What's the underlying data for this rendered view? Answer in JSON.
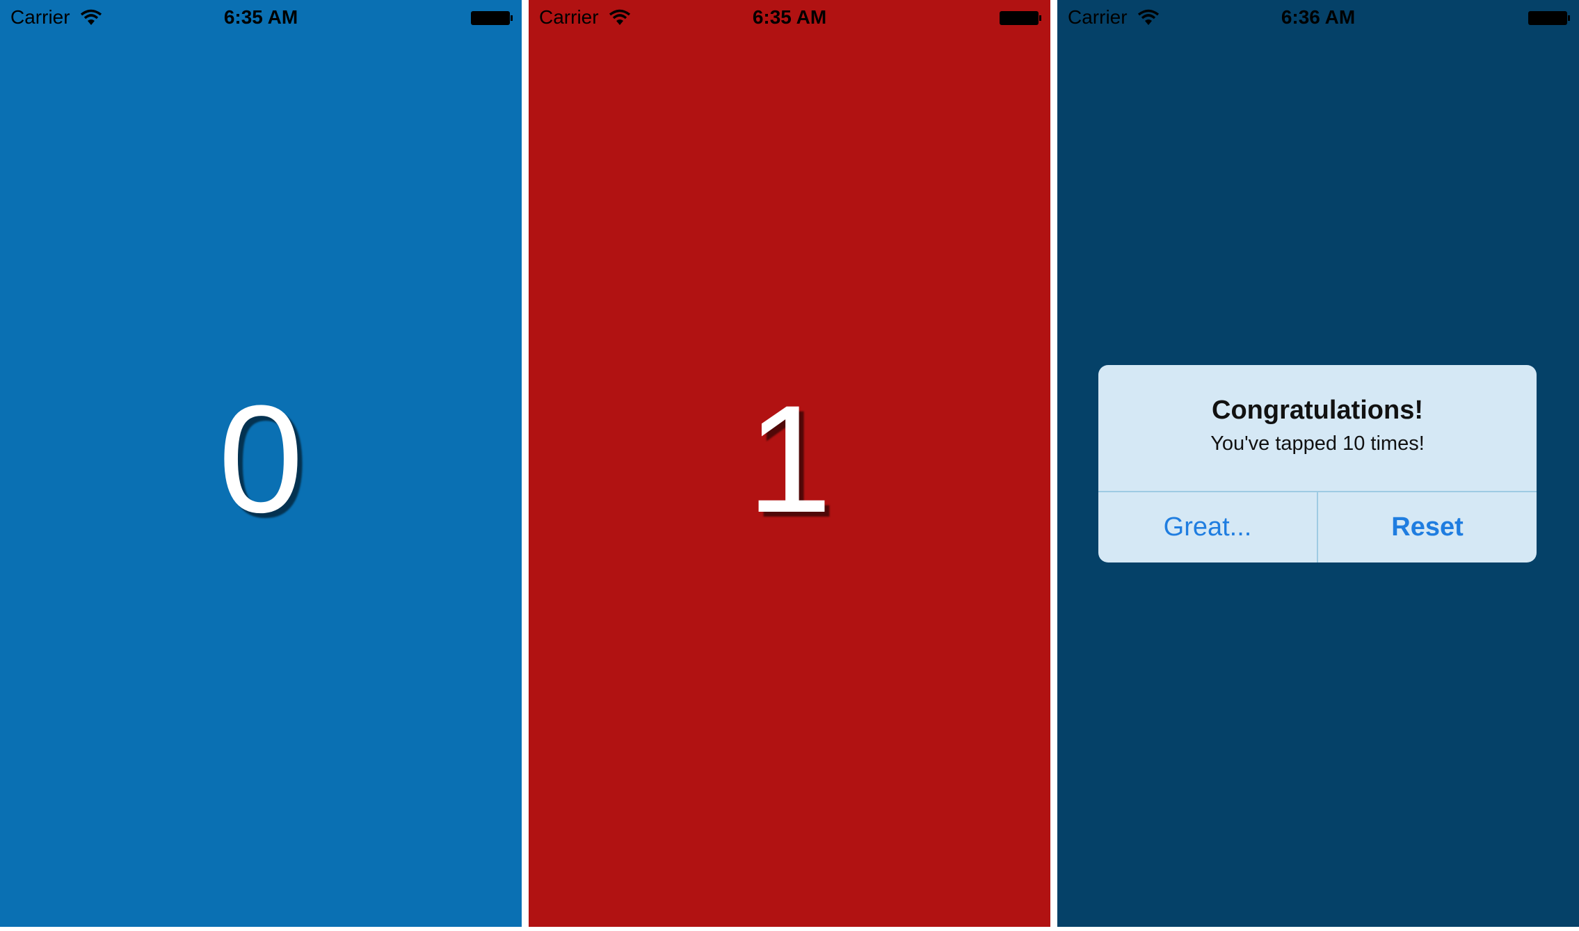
{
  "screens": [
    {
      "status": {
        "carrier": "Carrier",
        "time": "6:35 AM"
      },
      "counter": "0",
      "background": "#0a70b3"
    },
    {
      "status": {
        "carrier": "Carrier",
        "time": "6:35 AM"
      },
      "counter": "1",
      "background": "#b11212"
    },
    {
      "status": {
        "carrier": "Carrier",
        "time": "6:36 AM"
      },
      "background": "#054168",
      "alert": {
        "title": "Congratulations!",
        "message": "You've tapped 10 times!",
        "buttons": [
          "Great...",
          "Reset"
        ],
        "button_color": "#1f7de0"
      }
    }
  ]
}
